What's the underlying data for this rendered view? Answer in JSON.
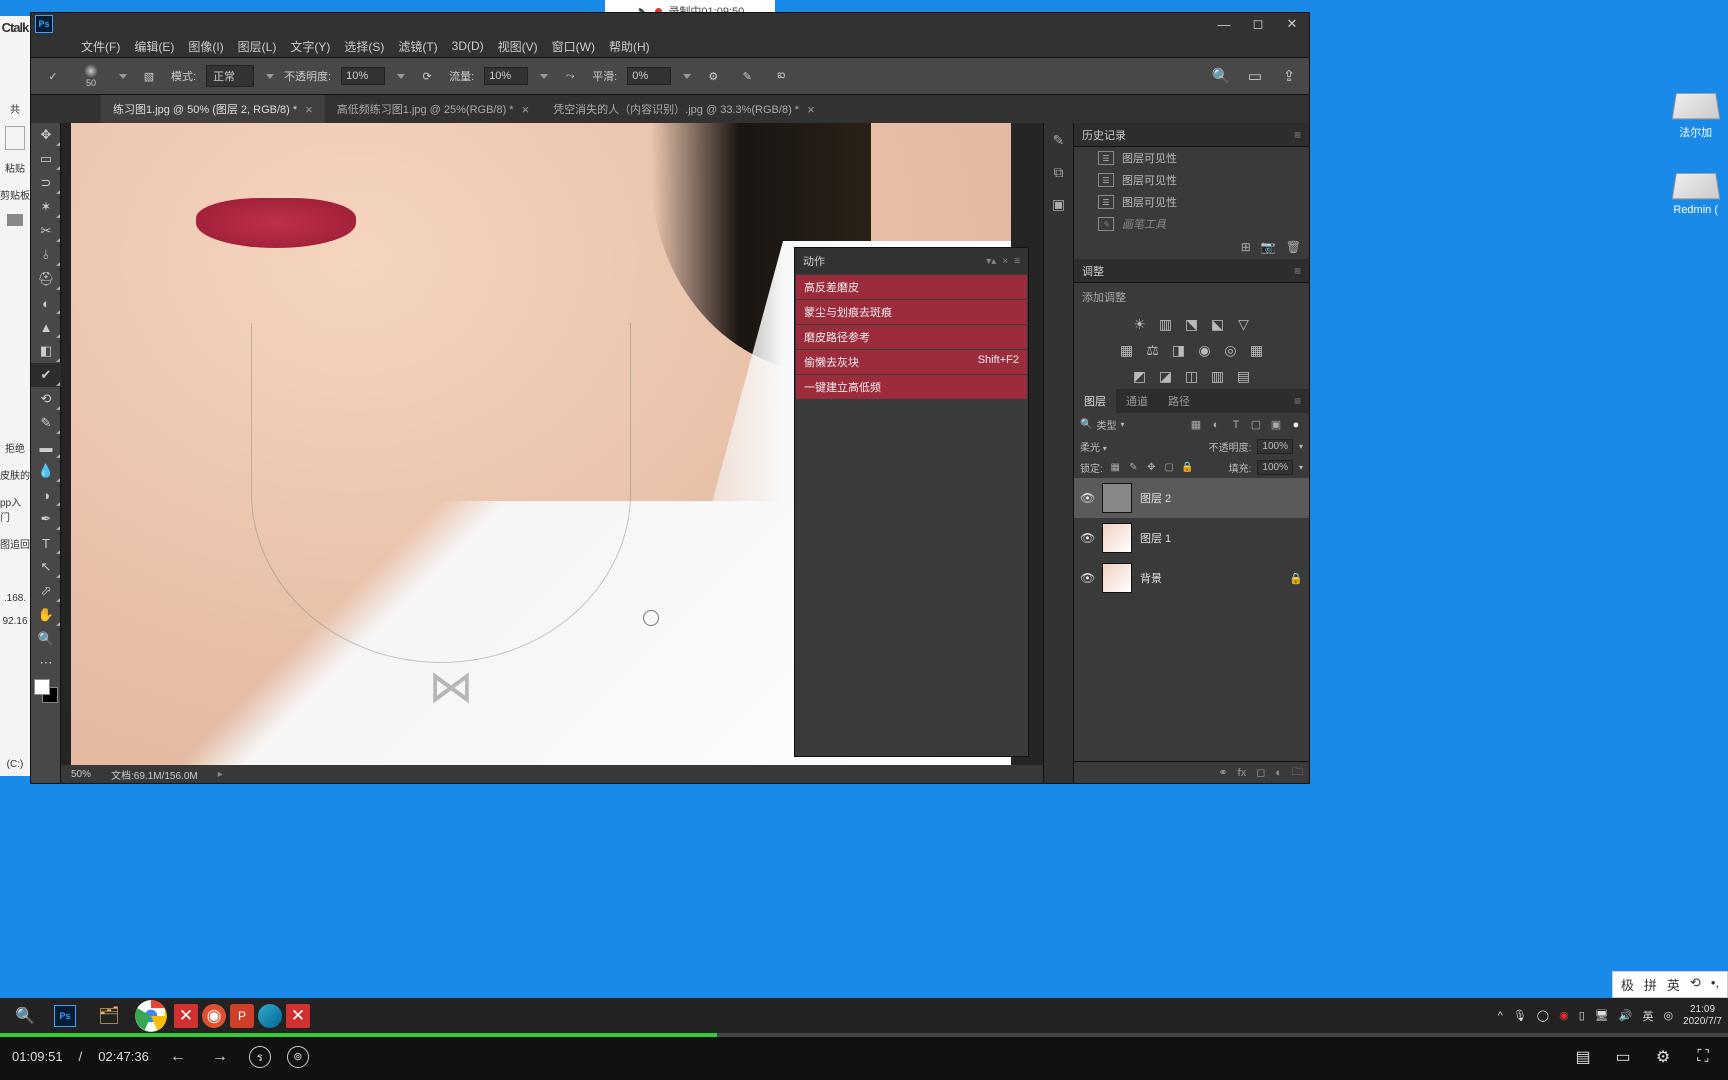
{
  "recorder": {
    "label": "录制中01:09:50"
  },
  "leftStrip": {
    "app": "Ctalk",
    "clipboard": "粘贴",
    "clipboardPanel": "剪贴板",
    "folder": "拒绝",
    "s1": "皮肤的",
    "s2": "pp入门",
    "s3": "图追回",
    "ip1": ".168.",
    "ip2": "92.16",
    "drive": "(C:)"
  },
  "menubar": [
    "文件(F)",
    "编辑(E)",
    "图像(I)",
    "图层(L)",
    "文字(Y)",
    "选择(S)",
    "滤镜(T)",
    "3D(D)",
    "视图(V)",
    "窗口(W)",
    "帮助(H)"
  ],
  "optionsBar": {
    "brushSize": "50",
    "modeLabel": "模式:",
    "mode": "正常",
    "opacityLabel": "不透明度:",
    "opacity": "10%",
    "flowLabel": "流量:",
    "flow": "10%",
    "smoothLabel": "平滑:",
    "smooth": "0%"
  },
  "tabs": [
    {
      "label": "练习图1.jpg @ 50% (图层 2, RGB/8) *",
      "active": true
    },
    {
      "label": "高低频练习图1.jpg @ 25%(RGB/8) *",
      "active": false
    },
    {
      "label": "凭空消失的人（内容识别）.jpg @ 33.3%(RGB/8) *",
      "active": false
    }
  ],
  "statusBar": {
    "zoom": "50%",
    "docInfo": "文档:69.1M/156.0M"
  },
  "actionsPanel": {
    "title": "动作",
    "items": [
      {
        "label": "高反差磨皮",
        "sc": ""
      },
      {
        "label": "蒙尘与划痕去斑痕",
        "sc": ""
      },
      {
        "label": "磨皮路径参考",
        "sc": ""
      },
      {
        "label": "偷懒去灰块",
        "sc": "Shift+F2"
      },
      {
        "label": "一键建立高低频",
        "sc": ""
      }
    ]
  },
  "historyPanel": {
    "title": "历史记录",
    "items": [
      "图层可见性",
      "图层可见性",
      "图层可见性"
    ],
    "dimItem": "画笔工具"
  },
  "adjustPanel": {
    "title": "调整",
    "addLabel": "添加调整"
  },
  "layersPanel": {
    "tabs": [
      "图层",
      "通道",
      "路径"
    ],
    "kind": "类型",
    "blendMode": "柔光",
    "opacityLabel": "不透明度:",
    "opacity": "100%",
    "lockLabel": "锁定:",
    "fillLabel": "填充:",
    "fill": "100%",
    "layers": [
      {
        "name": "图层 2",
        "selected": true,
        "thumb": "gray"
      },
      {
        "name": "图层 1",
        "selected": false,
        "thumb": "photo"
      },
      {
        "name": "背景",
        "selected": false,
        "thumb": "photo",
        "locked": true
      }
    ]
  },
  "desktopIcons": [
    {
      "label": "法尔加"
    },
    {
      "label": "Redmin ("
    }
  ],
  "taskbar": {
    "lang": "英",
    "time": "21:09",
    "date": "2020/7/7"
  },
  "ime": [
    "极",
    "拼",
    "英",
    "⟲",
    "•,"
  ],
  "video": {
    "current": "01:09:51",
    "total": "02:47:36"
  }
}
